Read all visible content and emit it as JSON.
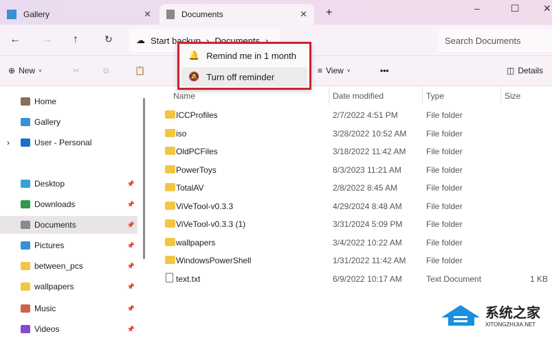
{
  "tabs": [
    {
      "label": "Gallery"
    },
    {
      "label": "Documents"
    }
  ],
  "nav": {
    "breadcrumb": [
      "Start backup",
      "Documents"
    ],
    "search_placeholder": "Search Documents"
  },
  "toolbar": {
    "new": "New",
    "view": "View",
    "more": "•••",
    "details": "Details"
  },
  "menu": {
    "items": [
      "Remind me in 1 month",
      "Turn off reminder"
    ]
  },
  "sidebar": [
    {
      "label": "Home",
      "color": "#8a6d5a"
    },
    {
      "label": "Gallery",
      "color": "#3a8fd6"
    },
    {
      "label": "User - Personal",
      "color": "#1a6fc9"
    },
    {
      "label": "Desktop",
      "color": "#3aa0d8"
    },
    {
      "label": "Downloads",
      "color": "#2e9a4a"
    },
    {
      "label": "Documents",
      "color": "#8a8a8a"
    },
    {
      "label": "Pictures",
      "color": "#3a8fd6"
    },
    {
      "label": "between_pcs",
      "color": "#f4c542"
    },
    {
      "label": "wallpapers",
      "color": "#f4c542"
    },
    {
      "label": "Music",
      "color": "#d0604a"
    },
    {
      "label": "Videos",
      "color": "#8a4ad0"
    }
  ],
  "columns": [
    "Name",
    "Date modified",
    "Type",
    "Size"
  ],
  "files": [
    {
      "name": "ICCProfiles",
      "date": "2/7/2022 4:51 PM",
      "type": "File folder",
      "size": ""
    },
    {
      "name": "iso",
      "date": "3/28/2022 10:52 AM",
      "type": "File folder",
      "size": ""
    },
    {
      "name": "OldPCFiles",
      "date": "3/18/2022 11:42 AM",
      "type": "File folder",
      "size": ""
    },
    {
      "name": "PowerToys",
      "date": "8/3/2023 11:21 AM",
      "type": "File folder",
      "size": ""
    },
    {
      "name": "TotalAV",
      "date": "2/8/2022 8:45 AM",
      "type": "File folder",
      "size": ""
    },
    {
      "name": "ViVeTool-v0.3.3",
      "date": "4/29/2024 8:48 AM",
      "type": "File folder",
      "size": ""
    },
    {
      "name": "ViVeTool-v0.3.3 (1)",
      "date": "3/31/2024 5:09 PM",
      "type": "File folder",
      "size": ""
    },
    {
      "name": "wallpapers",
      "date": "3/4/2022 10:22 AM",
      "type": "File folder",
      "size": ""
    },
    {
      "name": "WindowsPowerShell",
      "date": "1/31/2022 11:42 AM",
      "type": "File folder",
      "size": ""
    },
    {
      "name": "text.txt",
      "date": "6/9/2022 10:17 AM",
      "type": "Text Document",
      "size": "1 KB"
    }
  ],
  "watermark": {
    "cn": "系统之家",
    "en": "XITONGZHIJIA.NET"
  }
}
